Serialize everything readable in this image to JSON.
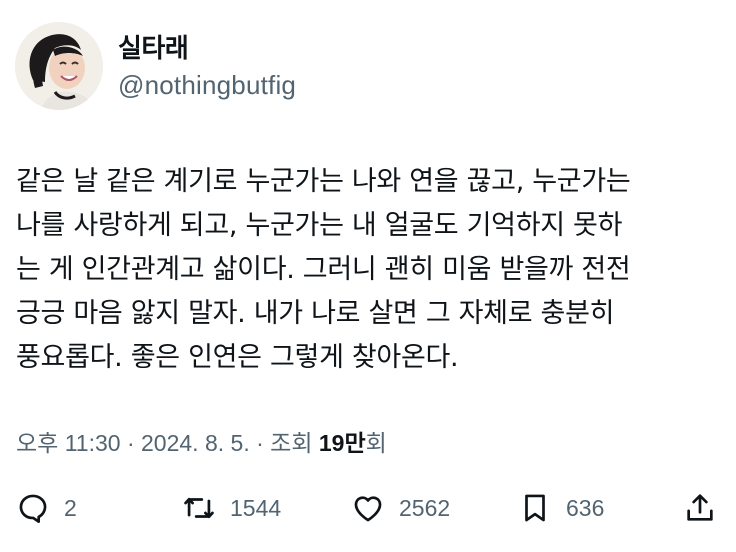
{
  "author": {
    "display_name": "실타래",
    "handle": "@nothingbutfig"
  },
  "tweet": {
    "lines": [
      "같은 날 같은 계기로 누군가는 나와 연을 끊고, 누군가는",
      "나를 사랑하게 되고, 누군가는 내 얼굴도 기억하지 못하",
      "는 게 인간관계고 삶이다. 그러니 괜히 미움 받을까 전전",
      "긍긍 마음 앓지 말자. 내가 나로 살면 그 자체로 충분히",
      "풍요롭다. 좋은 인연은 그렇게 찾아온다."
    ]
  },
  "meta": {
    "time": "오후 11:30",
    "sep1": " · ",
    "date": "2024. 8. 5.",
    "sep2": " · ",
    "views_label": "조회 ",
    "views_value": "19만",
    "views_suffix": "회"
  },
  "actions": {
    "reply_count": "2",
    "retweet_count": "1544",
    "like_count": "2562",
    "bookmark_count": "636"
  },
  "icons": {
    "reply": "reply-icon",
    "retweet": "retweet-icon",
    "like": "heart-icon",
    "bookmark": "bookmark-icon",
    "share": "share-icon"
  }
}
